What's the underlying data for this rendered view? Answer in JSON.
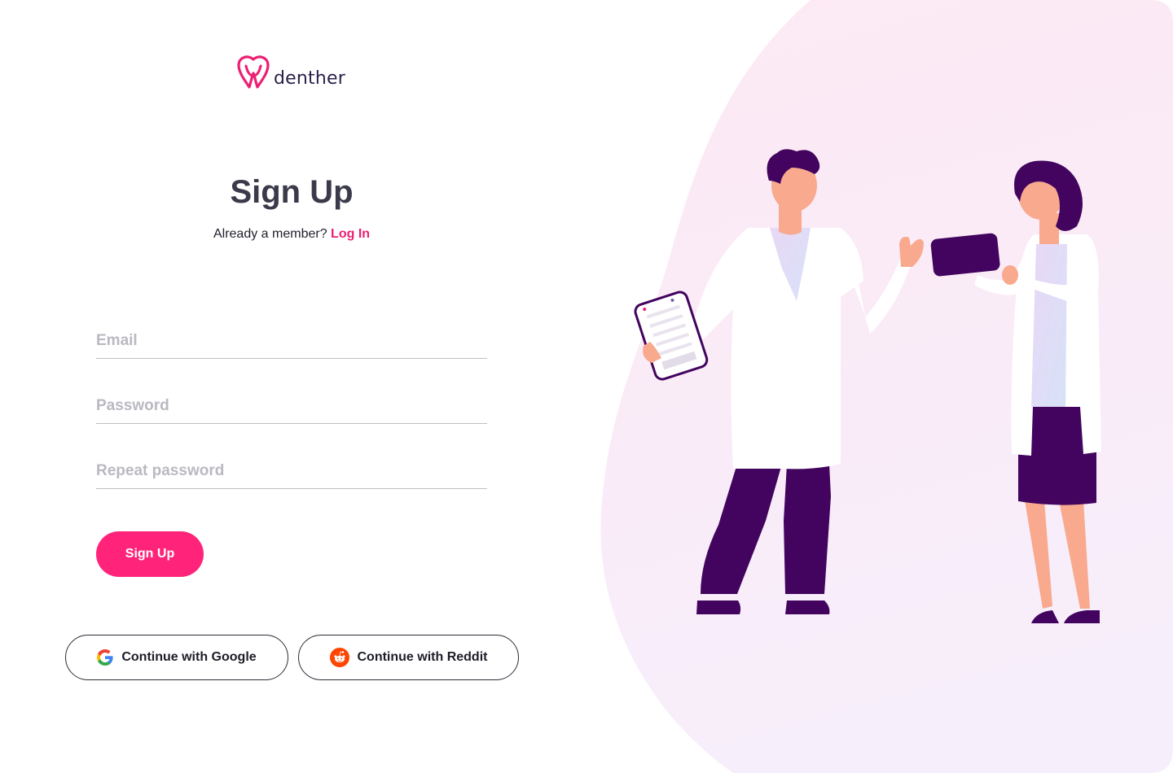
{
  "brand": {
    "name": "denther",
    "logo_color": "#ec1f74"
  },
  "form": {
    "title": "Sign Up",
    "already_member_text": "Already a member?",
    "login_link": "Log In",
    "email_placeholder": "Email",
    "password_placeholder": "Password",
    "repeat_password_placeholder": "Repeat password",
    "submit_label": "Sign Up"
  },
  "social": {
    "google_label": "Continue with Google",
    "reddit_label": "Continue with Reddit"
  },
  "colors": {
    "accent": "#ff2479",
    "link": "#ec1f74",
    "illustration_purple": "#42045e",
    "illustration_bg": "#fbeef6"
  },
  "icons": [
    "logo-icon",
    "google-icon",
    "reddit-icon"
  ]
}
